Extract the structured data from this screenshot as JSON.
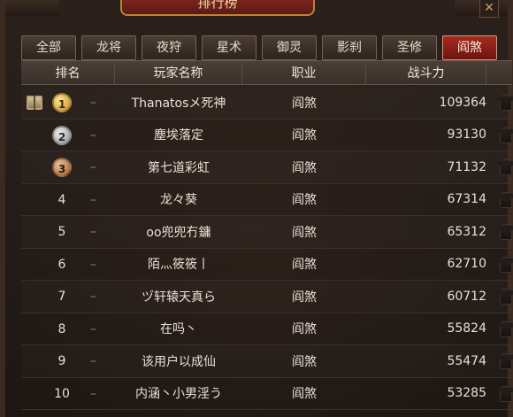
{
  "window": {
    "title": "排行榜",
    "close_label": "✕"
  },
  "tabs": [
    {
      "label": "全部",
      "active": false
    },
    {
      "label": "龙将",
      "active": false
    },
    {
      "label": "夜狩",
      "active": false
    },
    {
      "label": "星术",
      "active": false
    },
    {
      "label": "御灵",
      "active": false
    },
    {
      "label": "影刹",
      "active": false
    },
    {
      "label": "圣修",
      "active": false
    },
    {
      "label": "阎煞",
      "active": true
    }
  ],
  "table": {
    "headers": {
      "rank": "排名",
      "name": "玩家名称",
      "class": "职业",
      "power": "战斗力"
    },
    "rows": [
      {
        "rank": "1",
        "medal": "gold",
        "change": "–",
        "name": "Thanatosメ死神",
        "class": "阎煞",
        "power": "109364",
        "gift": true
      },
      {
        "rank": "2",
        "medal": "silver",
        "change": "–",
        "name": "塵埃落定",
        "class": "阎煞",
        "power": "93130",
        "gift": false
      },
      {
        "rank": "3",
        "medal": "bronze",
        "change": "–",
        "name": "第七道彩虹",
        "class": "阎煞",
        "power": "71132",
        "gift": false
      },
      {
        "rank": "4",
        "medal": null,
        "change": "–",
        "name": "龙々葵",
        "class": "阎煞",
        "power": "67314",
        "gift": false
      },
      {
        "rank": "5",
        "medal": null,
        "change": "–",
        "name": "oo兜兜冇鏞",
        "class": "阎煞",
        "power": "65312",
        "gift": false
      },
      {
        "rank": "6",
        "medal": null,
        "change": "–",
        "name": "陌灬筱筱丨",
        "class": "阎煞",
        "power": "62710",
        "gift": false
      },
      {
        "rank": "7",
        "medal": null,
        "change": "–",
        "name": "ヅ轩辕天真ら",
        "class": "阎煞",
        "power": "60712",
        "gift": false
      },
      {
        "rank": "8",
        "medal": null,
        "change": "–",
        "name": "在吗丶",
        "class": "阎煞",
        "power": "55824",
        "gift": false
      },
      {
        "rank": "9",
        "medal": null,
        "change": "–",
        "name": "该用户以成仙",
        "class": "阎煞",
        "power": "55474",
        "gift": false
      },
      {
        "rank": "10",
        "medal": null,
        "change": "–",
        "name": "内涵丶小男淫う",
        "class": "阎煞",
        "power": "53285",
        "gift": false
      }
    ]
  },
  "colors": {
    "active_tab": "#a52a22",
    "gold": "#c7891a",
    "silver": "#8b8b8b",
    "bronze": "#9a5a2a"
  },
  "icons": {
    "gift": "gift-icon",
    "armor": "armor-icon",
    "medal": "medal-icon"
  }
}
